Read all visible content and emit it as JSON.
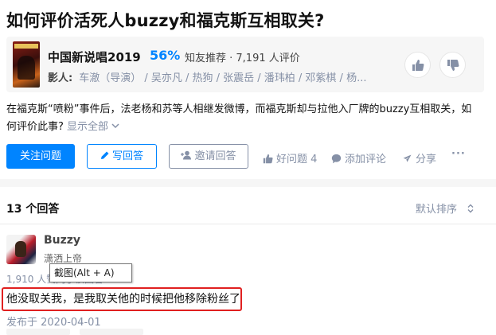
{
  "question": {
    "title": "如何评价活死人buzzy和福克斯互相取关?",
    "description": "在福克斯“喷粉”事件后，法老杨和苏等人相继发微博，而福克斯却与拉他入厂牌的buzzy互相取关，如何评价此事?",
    "show_all": "显示全部"
  },
  "movie": {
    "name": "中国新说唱2019",
    "percent": "56%",
    "recommend": "知友推荐 · 7,191 人评价",
    "cast_label": "影人:",
    "cast": "车澈（导演） / 吴亦凡 / 热狗 / 张震岳 / 潘玮柏 / 邓紫棋 / 杨..."
  },
  "actions": {
    "follow": "关注问题",
    "write": "写回答",
    "invite": "邀请回答",
    "good_question": "好问题 4",
    "comment": "添加评论",
    "share": "分享",
    "more": "···"
  },
  "answers": {
    "count_label": "13 个回答",
    "sort_label": "默认排序"
  },
  "answer": {
    "author": "Buzzy",
    "bio": "潇洒上帝",
    "votes": "1,910 人赞同了该回答",
    "content": "他没取关我，是我取关他的时候把他移除粉丝了",
    "date": "发布于 2020-04-01"
  },
  "tooltip": "截图(Alt + A)",
  "colors": {
    "accent": "#0084ff",
    "highlight_border": "#e02020",
    "muted": "#8590a6"
  },
  "icons": [
    "thumbs-up-icon",
    "thumbs-down-icon",
    "pencil-icon",
    "add-user-icon",
    "like-icon",
    "comment-icon",
    "share-icon",
    "more-icon",
    "chevron-down-icon",
    "sort-icon"
  ]
}
